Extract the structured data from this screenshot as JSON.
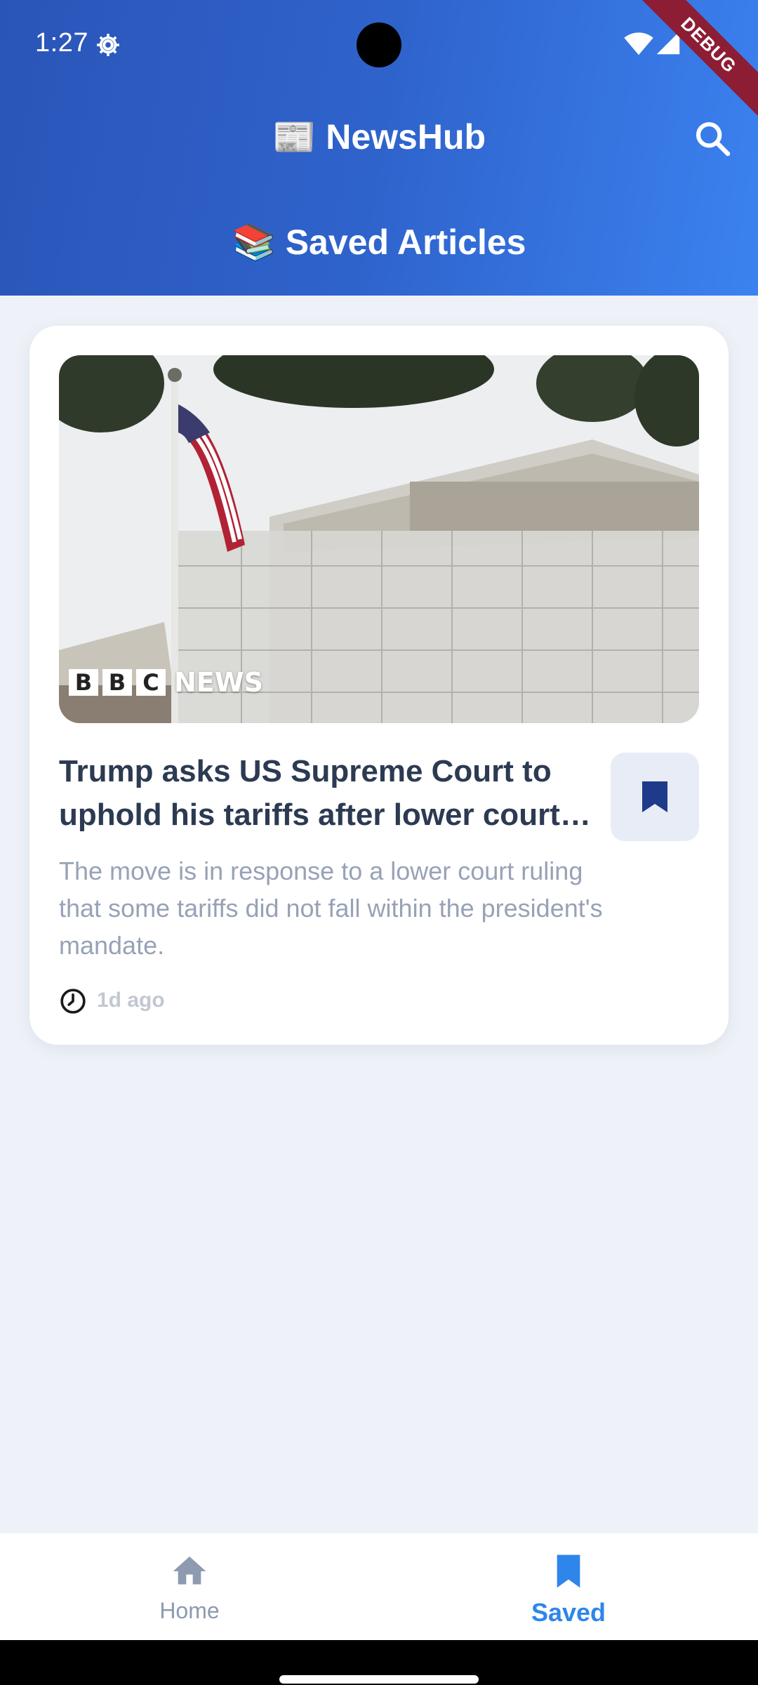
{
  "status_bar": {
    "time": "1:27"
  },
  "debug_banner": "DEBUG",
  "header": {
    "app_emoji": "📰",
    "app_name": "NewsHub",
    "section_emoji": "📚",
    "section_title": "Saved Articles"
  },
  "article": {
    "source_logo_letters": [
      "B",
      "B",
      "C"
    ],
    "source_logo_word": "NEWS",
    "title": "Trump asks US Supreme Court to uphold his tariffs after lower court ruling",
    "description": "The move is in response to a lower court ruling that some tariffs did not fall within the president's mandate.",
    "time_ago": "1d ago",
    "bookmarked": true
  },
  "bottom_nav": {
    "items": [
      {
        "label": "Home",
        "icon": "home-icon",
        "active": false
      },
      {
        "label": "Saved",
        "icon": "bookmark-icon",
        "active": true
      }
    ]
  },
  "colors": {
    "header_gradient_start": "#2a55b8",
    "header_gradient_end": "#3b82f0",
    "active_nav": "#2e86ea",
    "bookmark_fill": "#1e3a8a",
    "title_text": "#2c3a52"
  }
}
